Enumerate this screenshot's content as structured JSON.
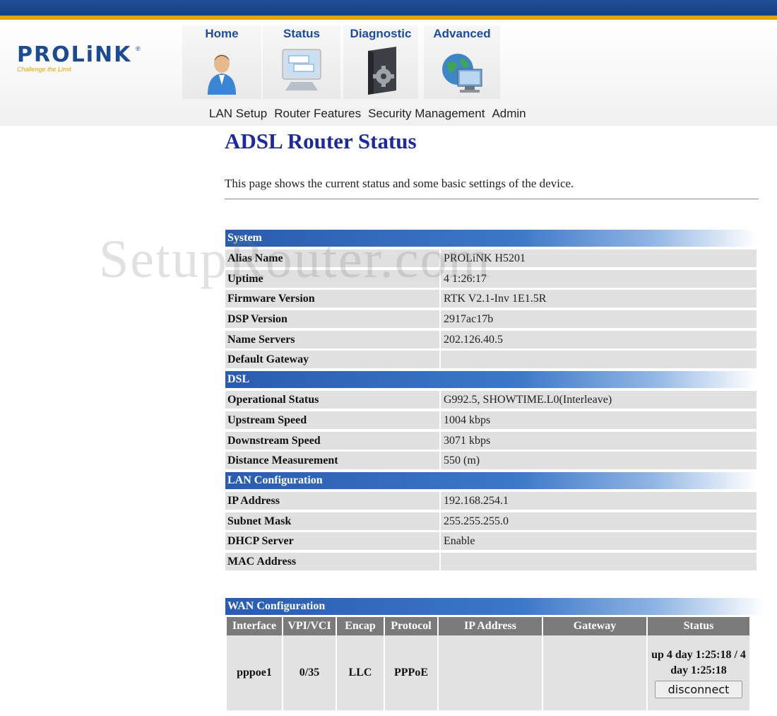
{
  "brand": {
    "logo": "PROLiNK",
    "tagline": "Challenge the Limit"
  },
  "nav": {
    "tabs": [
      {
        "label": "Home",
        "icon": "person-icon"
      },
      {
        "label": "Status",
        "icon": "monitor-icon"
      },
      {
        "label": "Diagnostic",
        "icon": "gear-icon"
      },
      {
        "label": "Advanced",
        "icon": "globe-icon"
      }
    ],
    "subnav": [
      "LAN Setup",
      "Router Features",
      "Security Management",
      "Admin"
    ]
  },
  "page": {
    "title": "ADSL Router Status",
    "description": "This page shows the current status and some basic settings of the device.",
    "watermark": "SetupRouter.com"
  },
  "system": {
    "title": "System",
    "rows": [
      {
        "label": "Alias Name",
        "value": "PROLiNK H5201"
      },
      {
        "label": "Uptime",
        "value": "4 1:26:17"
      },
      {
        "label": "Firmware Version",
        "value": "RTK V2.1-Inv 1E1.5R"
      },
      {
        "label": "DSP Version",
        "value": "2917ac17b"
      },
      {
        "label": "Name Servers",
        "value": "202.126.40.5"
      },
      {
        "label": "Default Gateway",
        "value": ""
      }
    ]
  },
  "dsl": {
    "title": "DSL",
    "rows": [
      {
        "label": "Operational Status",
        "value": "G992.5, SHOWTIME.L0(Interleave)"
      },
      {
        "label": "Upstream Speed",
        "value": "1004 kbps"
      },
      {
        "label": "Downstream Speed",
        "value": "3071 kbps"
      },
      {
        "label": "Distance Measurement",
        "value": "550 (m)"
      }
    ]
  },
  "lan": {
    "title": "LAN Configuration",
    "rows": [
      {
        "label": "IP Address",
        "value": "192.168.254.1"
      },
      {
        "label": "Subnet Mask",
        "value": "255.255.255.0"
      },
      {
        "label": "DHCP Server",
        "value": "Enable"
      },
      {
        "label": "MAC Address",
        "value": ""
      }
    ]
  },
  "wan": {
    "title": "WAN Configuration",
    "headers": [
      "Interface",
      "VPI/VCI",
      "Encap",
      "Protocol",
      "IP Address",
      "Gateway",
      "Status"
    ],
    "row": {
      "interface": "pppoe1",
      "vpivci": "0/35",
      "encap": "LLC",
      "protocol": "PPPoE",
      "ip": "",
      "gateway": "",
      "status": "up 4 day 1:25:18 / 4 day 1:25:18",
      "button": "disconnect"
    }
  },
  "colors": {
    "title": "#1c2a9a",
    "tab_label": "#1c4c9c",
    "section_bar": "#2a5cae",
    "top_bar": "#1f4f97",
    "accent": "#e1a70c"
  }
}
